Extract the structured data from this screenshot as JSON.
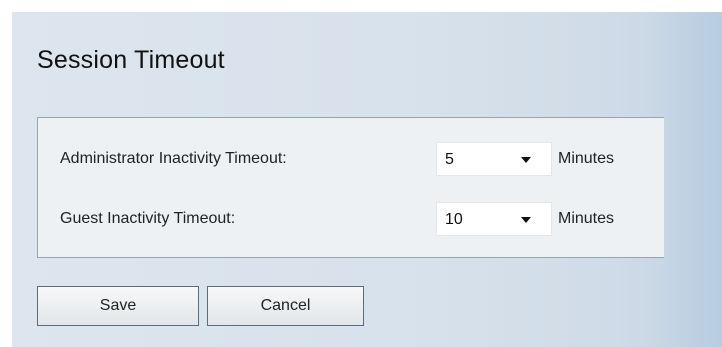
{
  "title": "Session Timeout",
  "settings": {
    "admin": {
      "label": "Administrator Inactivity Timeout:",
      "value": "5",
      "unit": "Minutes"
    },
    "guest": {
      "label": "Guest Inactivity Timeout:",
      "value": "10",
      "unit": "Minutes"
    }
  },
  "buttons": {
    "save": "Save",
    "cancel": "Cancel"
  },
  "icons": {
    "dropdown": "chevron-down-icon"
  }
}
